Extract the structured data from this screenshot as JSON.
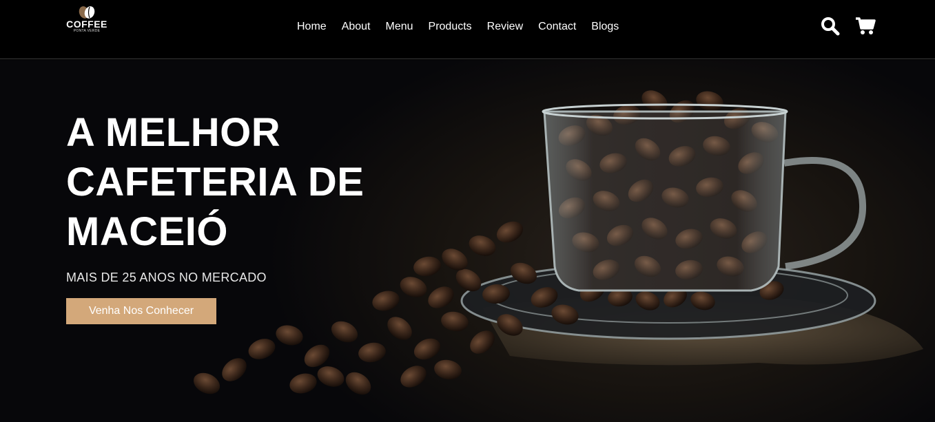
{
  "brand": {
    "name": "COFFEE",
    "tagline": "PONTA VERDE"
  },
  "nav": {
    "items": [
      {
        "label": "Home"
      },
      {
        "label": "About"
      },
      {
        "label": "Menu"
      },
      {
        "label": "Products"
      },
      {
        "label": "Review"
      },
      {
        "label": "Contact"
      },
      {
        "label": "Blogs"
      }
    ]
  },
  "header_icons": {
    "search": "search-icon",
    "cart": "cart-icon"
  },
  "hero": {
    "title_lines": [
      "A MELHOR",
      "CAFETERIA DE",
      "MACEIÓ"
    ],
    "subtitle": "MAIS DE 25 ANOS NO MERCADO",
    "cta_label": "Venha Nos Conhecer",
    "image": "coffee-beans-glass-cup"
  },
  "colors": {
    "accent": "#d3a87a",
    "header_bg": "#000000",
    "text": "#ffffff"
  }
}
